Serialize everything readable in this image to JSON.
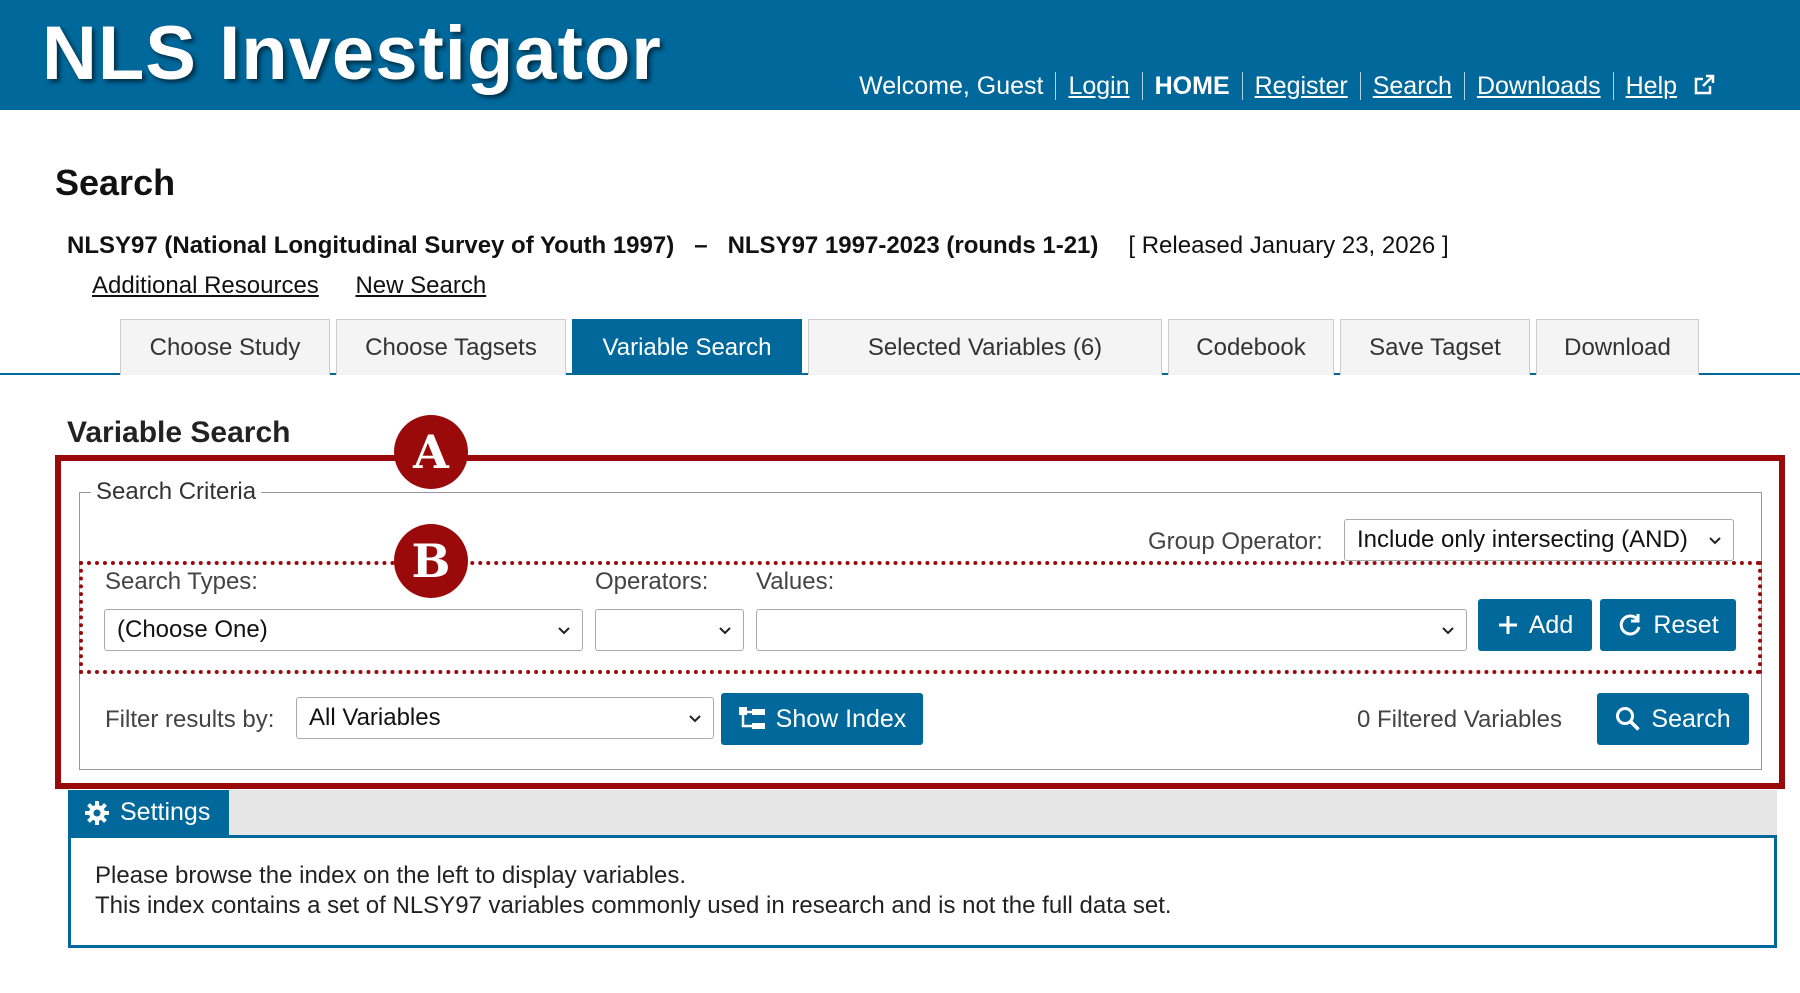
{
  "header": {
    "app_title": "NLS Investigator",
    "welcome": "Welcome, Guest",
    "nav": {
      "login": "Login",
      "home": "HOME",
      "register": "Register",
      "search": "Search",
      "downloads": "Downloads",
      "help": "Help"
    }
  },
  "page": {
    "title": "Search",
    "study_name": "NLSY97 (National Longitudinal Survey of Youth 1997)",
    "dash": "–",
    "release_name": "NLSY97 1997-2023 (rounds 1-21)",
    "released": "[ Released January 23, 2026 ]",
    "links": {
      "additional_resources": "Additional Resources",
      "new_search": "New Search"
    }
  },
  "tabs": [
    {
      "label": "Choose Study"
    },
    {
      "label": "Choose Tagsets"
    },
    {
      "label": "Variable Search"
    },
    {
      "label": "Selected Variables (6)"
    },
    {
      "label": "Codebook"
    },
    {
      "label": "Save Tagset"
    },
    {
      "label": "Download"
    }
  ],
  "variable_search": {
    "title": "Variable Search",
    "legend": "Search Criteria",
    "group_operator_label": "Group Operator:",
    "group_operator_value": "Include only intersecting (AND)",
    "search_types_label": "Search Types:",
    "search_types_value": "(Choose One)",
    "operators_label": "Operators:",
    "operators_value": "",
    "values_label": "Values:",
    "values_value": "",
    "add_label": "Add",
    "reset_label": "Reset",
    "filter_label": "Filter results by:",
    "filter_value": "All Variables",
    "show_index_label": "Show Index",
    "filtered_count": "0 Filtered Variables",
    "search_label": "Search"
  },
  "annotations": {
    "marker_a": "A",
    "marker_b": "B",
    "accent_color": "#9b0a0a"
  },
  "settings": {
    "tab_label": "Settings",
    "line1": "Please browse the index on the left to display variables.",
    "line2": "This index contains a set of NLSY97 variables commonly used in research and is not the full data set."
  },
  "colors": {
    "brand_blue": "#01689b",
    "annotation_red": "#9b0a0a"
  }
}
